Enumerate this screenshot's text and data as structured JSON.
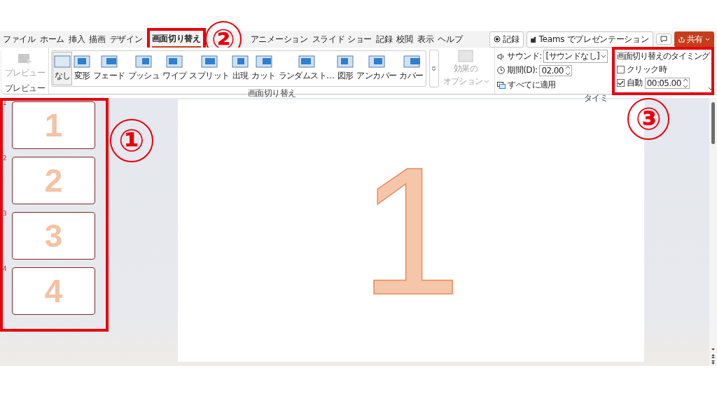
{
  "menu_tabs": [
    {
      "label": "ファイル",
      "selected": false
    },
    {
      "label": "ホーム",
      "selected": false
    },
    {
      "label": "挿入",
      "selected": false
    },
    {
      "label": "描画",
      "selected": false
    },
    {
      "label": "デザイン",
      "selected": false
    },
    {
      "label": "画面切り替え",
      "selected": true
    },
    {
      "label": "アニメーション",
      "selected": false
    },
    {
      "label": "スライド ショー",
      "selected": false
    },
    {
      "label": "記録",
      "selected": false
    },
    {
      "label": "校閲",
      "selected": false
    },
    {
      "label": "表示",
      "selected": false
    },
    {
      "label": "ヘルプ",
      "selected": false
    }
  ],
  "top_buttons": {
    "record": "記録",
    "teams": "Teams でプレゼンテーション",
    "share": "共有"
  },
  "ribbon": {
    "preview": {
      "label": "プレビュー",
      "disabled": true
    },
    "preview_group": "プレビュー",
    "transitions": [
      {
        "label": "なし",
        "selected": true
      },
      {
        "label": "変形",
        "selected": false
      },
      {
        "label": "フェード",
        "selected": false
      },
      {
        "label": "プッシュ",
        "selected": false
      },
      {
        "label": "ワイプ",
        "selected": false
      },
      {
        "label": "スプリット",
        "selected": false
      },
      {
        "label": "出現",
        "selected": false
      },
      {
        "label": "カット",
        "selected": false
      },
      {
        "label": "ランダムスト…",
        "selected": false
      },
      {
        "label": "図形",
        "selected": false
      },
      {
        "label": "アンカバー",
        "selected": false
      },
      {
        "label": "カバー",
        "selected": false
      }
    ],
    "transitions_group": "画面切り替え",
    "effect_options": {
      "line_1": "効果の",
      "line_2": "オプション",
      "disabled": true
    },
    "sound": {
      "label": "サウンド:",
      "value": "[サウンドなし]"
    },
    "duration": {
      "label": "期間(D):",
      "value": "02.00"
    },
    "apply_all": "すべてに適用",
    "timing_group": "タイミ",
    "advance": {
      "title": "画面切り替えのタイミング",
      "on_click": {
        "label": "クリック時",
        "checked": false
      },
      "auto": {
        "label": "自動",
        "checked": true,
        "value": "00:05.00"
      }
    }
  },
  "slides": [
    {
      "number": "1",
      "text": "1"
    },
    {
      "number": "2",
      "text": "2"
    },
    {
      "number": "3",
      "text": "3"
    },
    {
      "number": "4",
      "text": "4"
    }
  ],
  "main_slide": {
    "text": "1"
  },
  "annotations": [
    "①",
    "②",
    "③"
  ]
}
